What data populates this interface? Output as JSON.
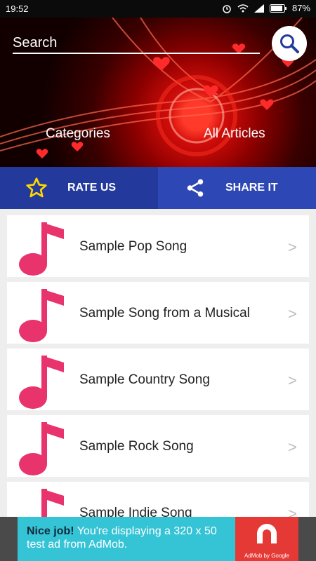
{
  "status_bar": {
    "time": "19:52",
    "battery": "87%",
    "icons": [
      "alarm-icon",
      "wifi-icon",
      "signal-icon",
      "battery-icon"
    ]
  },
  "search": {
    "placeholder": "Search",
    "icon": "search-icon"
  },
  "hero_tabs": {
    "categories": "Categories",
    "all_articles": "All Articles"
  },
  "actions": {
    "rate_label": "RATE US",
    "rate_icon": "star-icon",
    "share_label": "SHARE IT",
    "share_icon": "share-icon"
  },
  "songs": [
    {
      "title": "Sample Pop Song",
      "chevron": ">"
    },
    {
      "title": "Sample Song from a Musical",
      "chevron": ">"
    },
    {
      "title": "Sample Country Song",
      "chevron": ">"
    },
    {
      "title": "Sample Rock Song",
      "chevron": ">"
    },
    {
      "title": "Sample Indie Song",
      "chevron": ">"
    }
  ],
  "ad": {
    "headline": "Nice job!",
    "body": "You're displaying a 320 x 50 test ad from AdMob.",
    "brand": "AdMob by Google"
  },
  "colors": {
    "accent_pink": "#e8336d",
    "rate_bg": "#23399c",
    "share_bg": "#2d48b4",
    "ad_bg": "#35c3d6",
    "ad_logo": "#e53935"
  }
}
